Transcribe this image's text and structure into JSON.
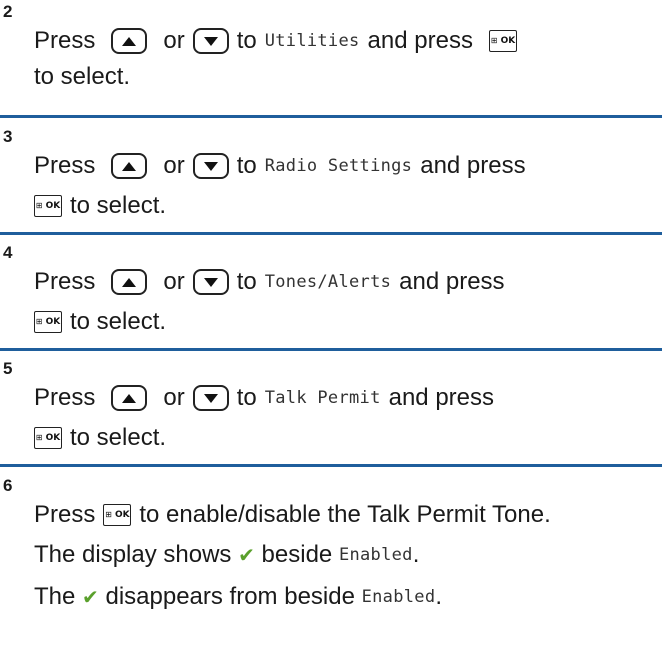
{
  "steps": [
    {
      "number": "2",
      "press": "Press",
      "or": "or",
      "to": "to",
      "menu_item": "Utilities",
      "and_press": "and press",
      "to_select": "to select."
    },
    {
      "number": "3",
      "press": "Press",
      "or": "or",
      "to": "to",
      "menu_item": "Radio Settings",
      "and_press": "and press",
      "to_select": "to select."
    },
    {
      "number": "4",
      "press": "Press",
      "or": "or",
      "to": "to",
      "menu_item": "Tones/Alerts",
      "and_press": "and press",
      "to_select": "to select."
    },
    {
      "number": "5",
      "press": "Press",
      "or": "or",
      "to": "to",
      "menu_item": "Talk Permit",
      "and_press": "and press",
      "to_select": "to select."
    }
  ],
  "step6": {
    "number": "6",
    "press": "Press",
    "instruction": "to enable/disable the Talk Permit Tone.",
    "result_enabled_prefix": "The display shows",
    "result_enabled_mid": "beside",
    "result_enabled_item": "Enabled",
    "result_enabled_end": ".",
    "result_disabled_prefix": "The",
    "result_disabled_mid": "disappears from beside",
    "result_disabled_item": "Enabled",
    "result_disabled_end": "."
  },
  "icons": {
    "up_button": "up-arrow-button-icon",
    "down_button": "down-arrow-button-icon",
    "ok_button": "menu-ok-button-icon",
    "check": "checkmark-icon"
  },
  "ok_label": "OK",
  "colors": {
    "separator": "#1f5e9c",
    "check": "#5aa02c"
  }
}
